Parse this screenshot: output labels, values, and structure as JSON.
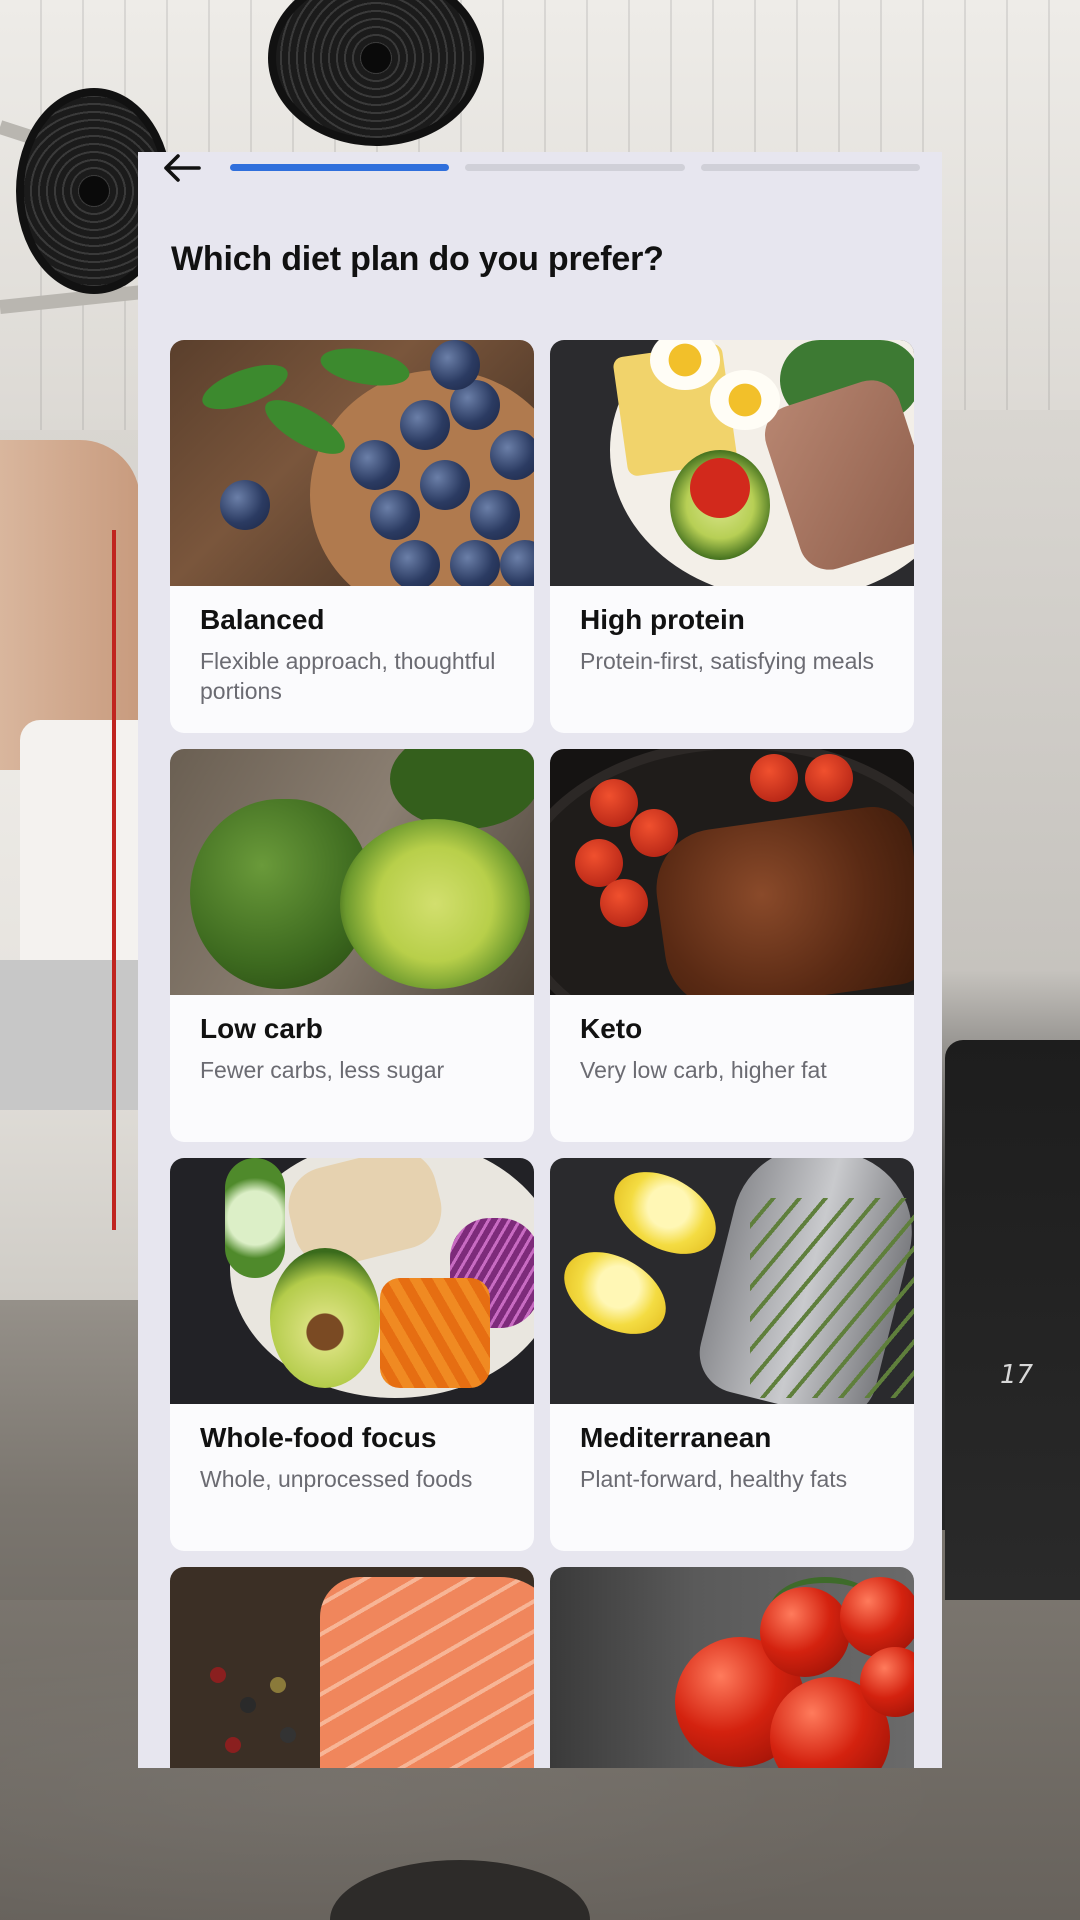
{
  "screen": {
    "title": "Which diet plan do you prefer?",
    "progress": {
      "total_steps": 3,
      "current_step": 1
    },
    "back_label": "Back"
  },
  "options": [
    {
      "label": "Balanced",
      "description": "Flexible approach, thoughtful portions",
      "image": "blueberries-photo"
    },
    {
      "label": "High protein",
      "description": "Protein-first, satisfying meals",
      "image": "protein-plate-photo"
    },
    {
      "label": "Low carb",
      "description": "Fewer carbs, less sugar",
      "image": "avocado-photo"
    },
    {
      "label": "Keto",
      "description": "Very low carb, higher fat",
      "image": "steak-photo"
    },
    {
      "label": "Whole-food focus",
      "description": "Whole, unprocessed foods",
      "image": "buddha-bowl-photo"
    },
    {
      "label": "Mediterranean",
      "description": "Plant-forward, healthy fats",
      "image": "fish-lemon-photo"
    },
    {
      "label": "",
      "description": "",
      "image": "salmon-photo"
    },
    {
      "label": "",
      "description": "",
      "image": "tomatoes-photo"
    }
  ],
  "colors": {
    "accent": "#2f6fdc",
    "panel_background": "#e7e6ef",
    "card_background": "#fbfbfd",
    "progress_inactive": "#d0d0d8",
    "title_text": "#111111",
    "description_text": "#6b6b72"
  },
  "icons": {
    "back": "arrow-left-icon"
  }
}
